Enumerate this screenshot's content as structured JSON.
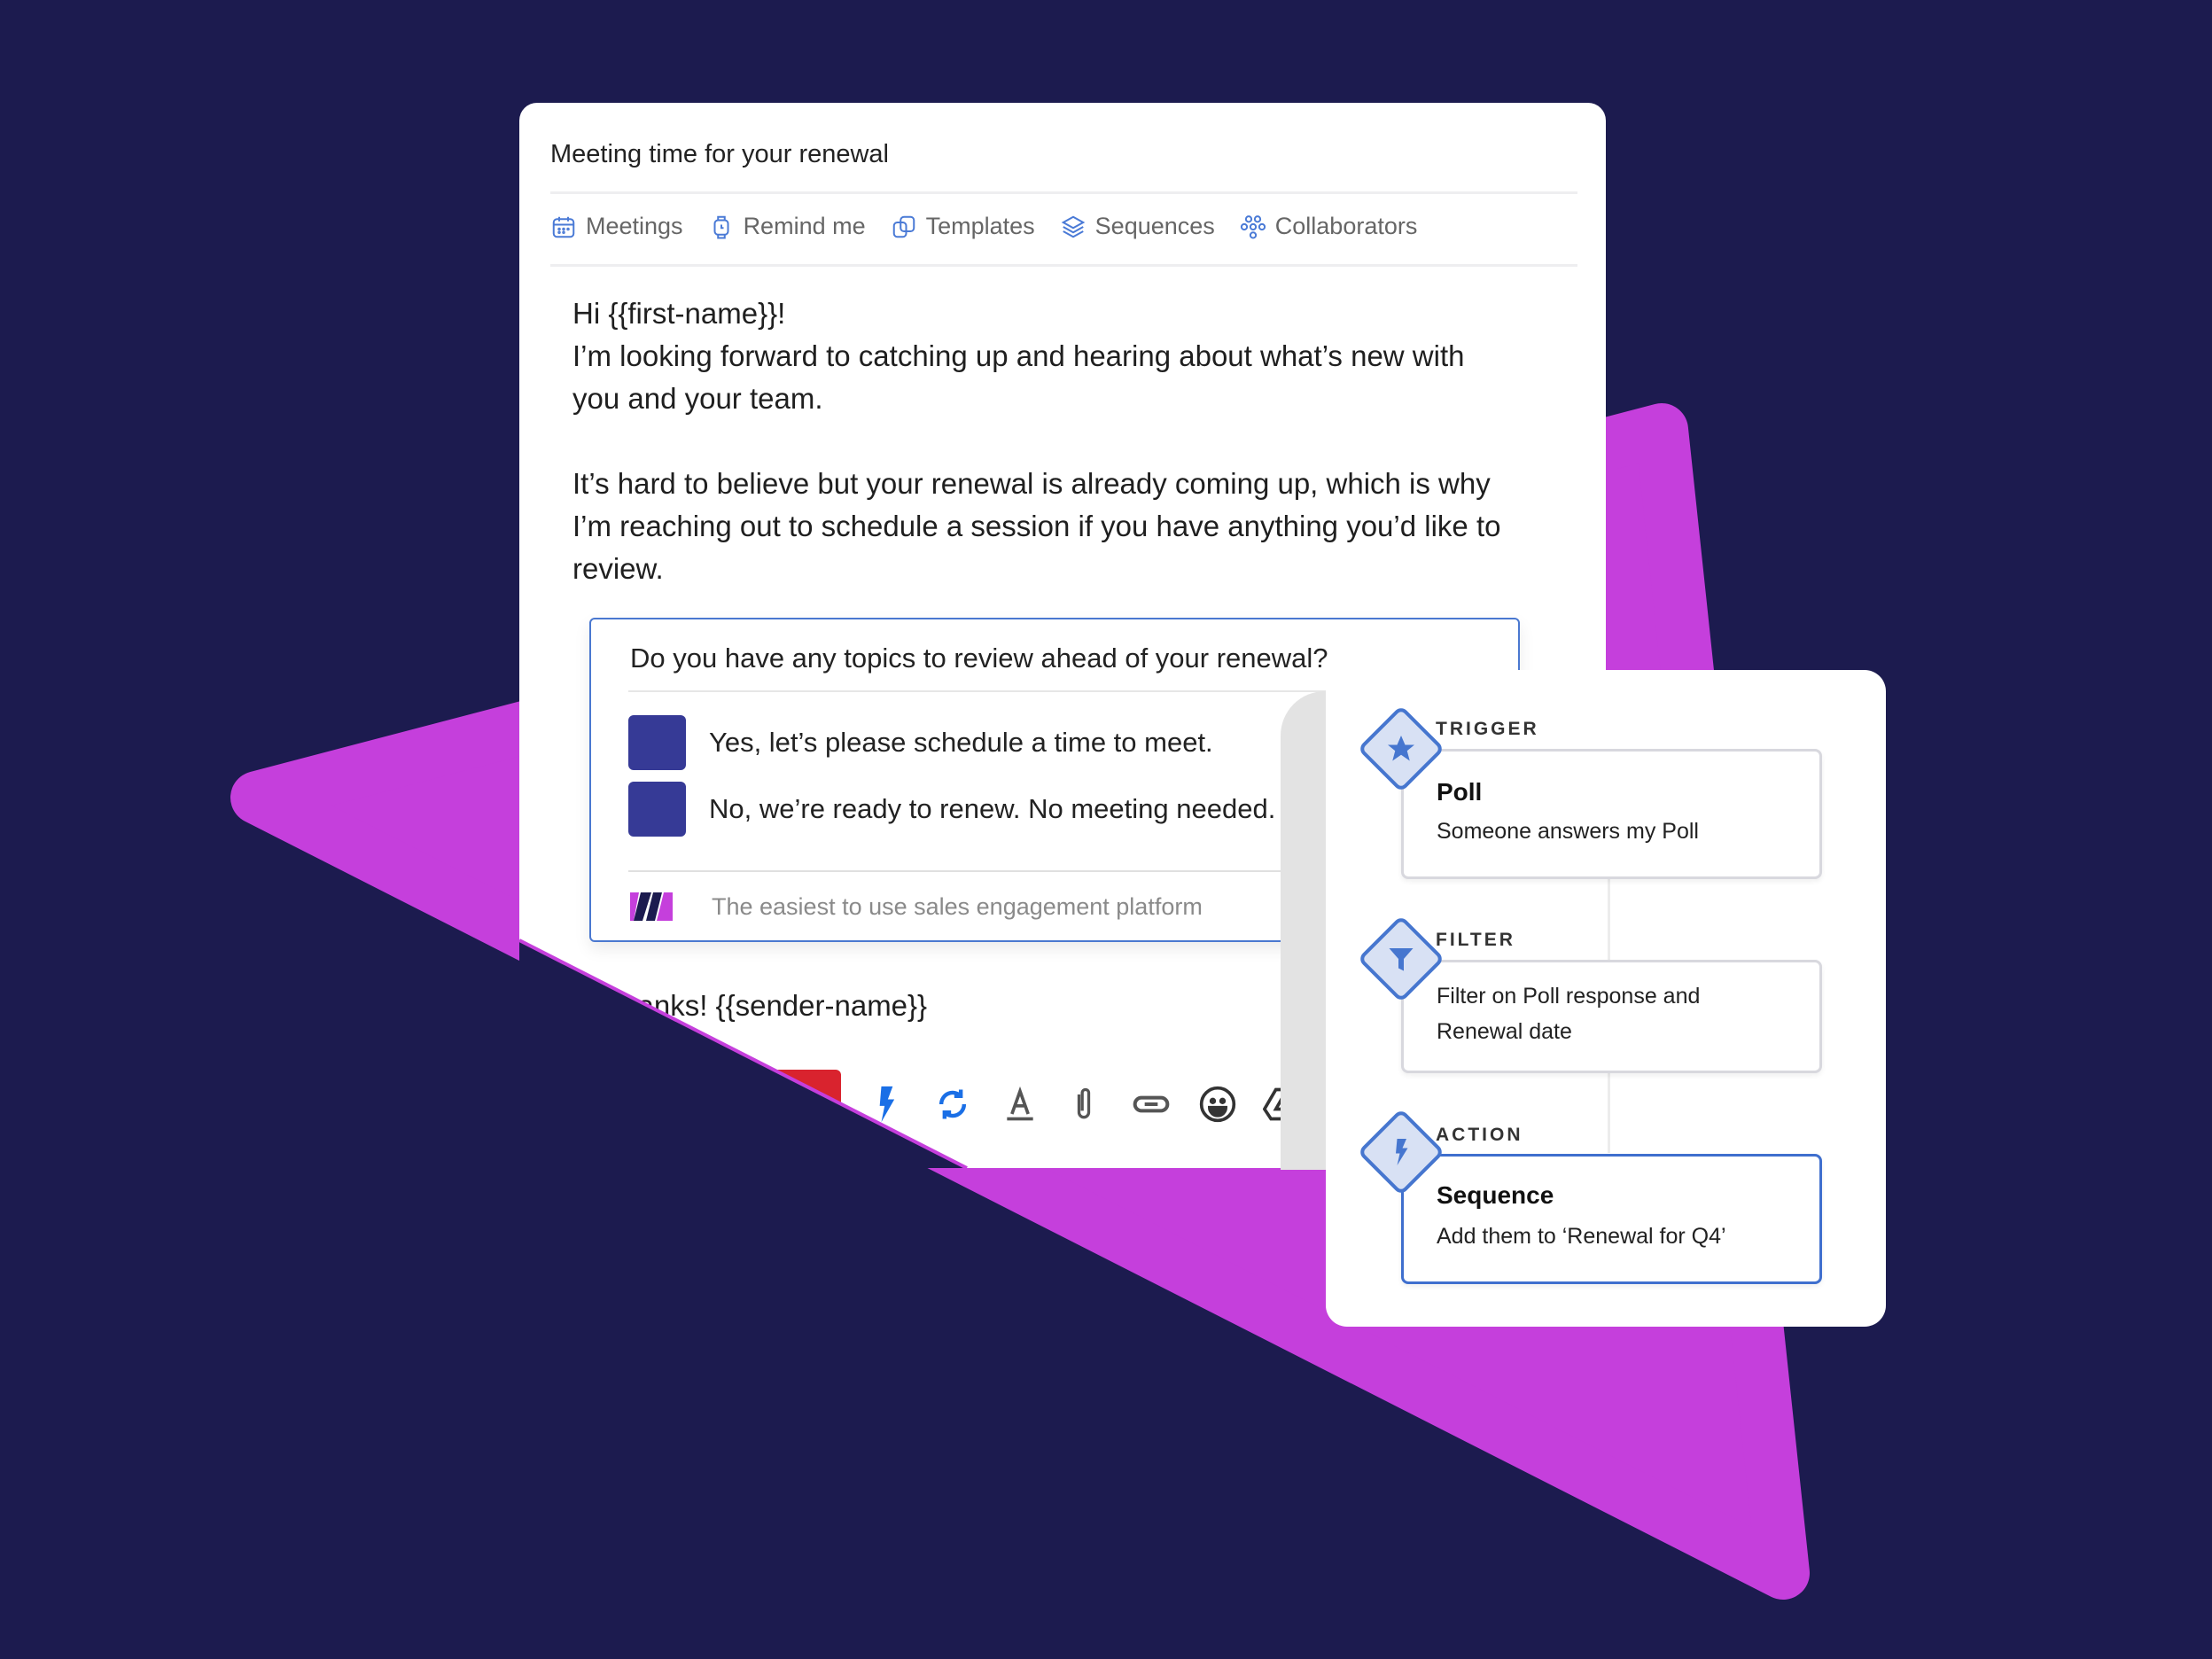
{
  "colors": {
    "background": "#1c1b4f",
    "accent_purple": "#c53fdc",
    "poll_checkbox": "#363a96",
    "workflow_blue": "#4676cf",
    "send_red": "#d9232e"
  },
  "email": {
    "subject": "Meeting time for your renewal",
    "tabs": [
      {
        "label": "Meetings",
        "icon": "calendar-icon"
      },
      {
        "label": "Remind me",
        "icon": "watch-icon"
      },
      {
        "label": "Templates",
        "icon": "templates-icon"
      },
      {
        "label": "Sequences",
        "icon": "layers-icon"
      },
      {
        "label": "Collaborators",
        "icon": "collaborators-icon"
      }
    ],
    "body": {
      "greeting": "Hi {{first-name}}!",
      "line1": "I’m looking forward to catching up and hearing about what’s new with you and your team.",
      "para2": "It’s hard to believe but your renewal is already coming up, which is why I’m reaching out to schedule a session if you have anything you’d like to review."
    },
    "poll": {
      "question": "Do you have any topics to review ahead of your renewal?",
      "options": [
        "Yes, let’s please schedule a time to meet.",
        "No, we’re ready to renew. No meeting needed."
      ],
      "footer": "The easiest to use sales engagement platform",
      "logo": "mixmax-logo"
    },
    "signoff": "Thanks! {{sender-name}}",
    "toolbar": [
      "send-button",
      "lightning-icon",
      "sync-icon",
      "text-format-icon",
      "attachment-icon",
      "link-icon",
      "emoji-icon",
      "drive-icon"
    ]
  },
  "workflow": {
    "steps": [
      {
        "label": "TRIGGER",
        "title": "Poll",
        "description": "Someone answers my Poll",
        "icon": "star-icon"
      },
      {
        "label": "FILTER",
        "title": "",
        "description": "Filter on Poll response and Renewal date",
        "icon": "filter-icon"
      },
      {
        "label": "ACTION",
        "title": "Sequence",
        "description": "Add them to ‘Renewal for Q4’",
        "icon": "lightning-icon"
      }
    ]
  }
}
